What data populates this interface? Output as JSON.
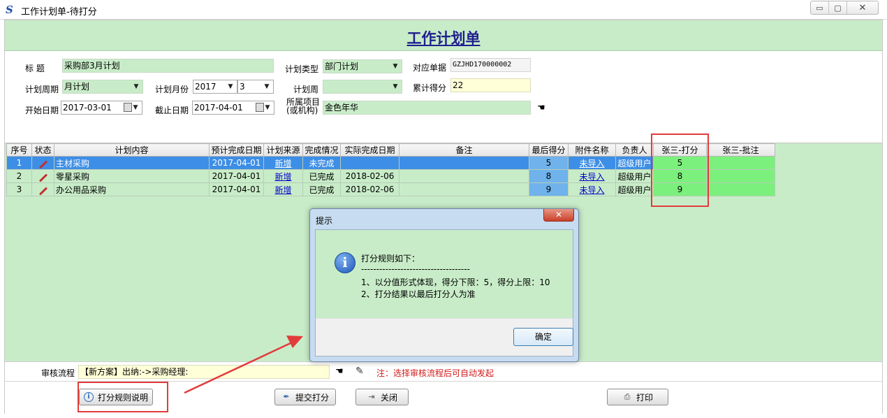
{
  "window": {
    "title": "工作计划单-待打分",
    "buttons": [
      "▭",
      "▢",
      "✕"
    ]
  },
  "page": {
    "heading": "工作计划单"
  },
  "form": {
    "title_label": "标    题",
    "title_value": "采购部3月计划",
    "plan_type_label": "计划类型",
    "plan_type_value": "部门计划",
    "ref_doc_label": "对应单据",
    "ref_doc_value": "GZJHD170000002",
    "period_label": "计划周期",
    "period_value": "月计划",
    "month_label": "计划月份",
    "year_value": "2017",
    "month_value": "3",
    "week_label": "计划周",
    "week_value": "",
    "total_score_label": "累计得分",
    "total_score_value": "22",
    "start_label": "开始日期",
    "start_value": "2017-03-01",
    "end_label": "截止日期",
    "end_value": "2017-04-01",
    "project_label_1": "所属项目",
    "project_label_2": "(或机构)",
    "project_value": "金色年华"
  },
  "table": {
    "headers": [
      "序号",
      "状态",
      "计划内容",
      "预计完成日期",
      "计划来源",
      "完成情况",
      "实际完成日期",
      "备注",
      "最后得分",
      "附件名称",
      "负责人",
      "张三-打分",
      "张三-批注"
    ],
    "rows": [
      {
        "no": "1",
        "content": "主材采购",
        "due": "2017-04-01",
        "source": "新增",
        "status": "未完成",
        "done": "",
        "note": "",
        "final": "5",
        "attach": "未导入",
        "owner": "超级用户",
        "score": "5",
        "comment": ""
      },
      {
        "no": "2",
        "content": "零星采购",
        "due": "2017-04-01",
        "source": "新增",
        "status": "已完成",
        "done": "2018-02-06",
        "note": "",
        "final": "8",
        "attach": "未导入",
        "owner": "超级用户",
        "score": "8",
        "comment": ""
      },
      {
        "no": "3",
        "content": "办公用品采购",
        "due": "2017-04-01",
        "source": "新增",
        "status": "已完成",
        "done": "2018-02-06",
        "note": "",
        "final": "9",
        "attach": "未导入",
        "owner": "超级用户",
        "score": "9",
        "comment": ""
      }
    ]
  },
  "flow": {
    "label": "审核流程",
    "value": "【新方案】出纳:->采购经理:",
    "note": "注：选择审核流程后可自动发起"
  },
  "buttons": {
    "rules": "打分规则说明",
    "submit": "提交打分",
    "close": "关闭",
    "print": "打印"
  },
  "dialog": {
    "title": "提示",
    "close": "✕",
    "line1": "打分规则如下：",
    "line2": "------------------------------------",
    "line3": "1、以分值形式体现，得分下限：5，得分上限：10",
    "line4": "2、打分结果以最后打分人为准",
    "ok": "确定"
  },
  "colors": {
    "form_green": "#c8ecc8",
    "selection_blue": "#3d8ee6",
    "highlight_red": "#e23b3b",
    "score_green": "#7cf07c"
  }
}
